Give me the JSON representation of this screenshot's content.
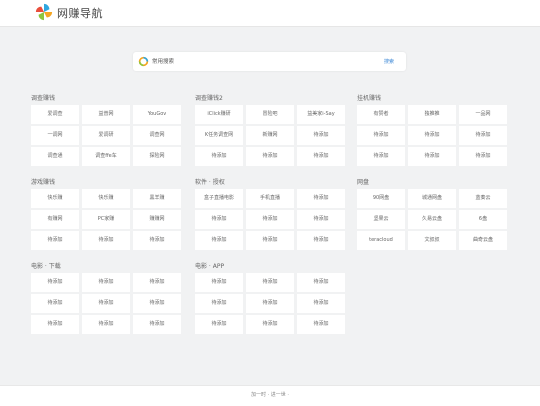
{
  "header": {
    "site_title": "网赚导航",
    "logo_colors": [
      "#2ea7e0",
      "#f5a623",
      "#8cc63f",
      "#e94e3c"
    ]
  },
  "search": {
    "engine_icon": "search-engine-ring-icon",
    "placeholder": "常用搜索",
    "button_label": "搜索"
  },
  "sections": [
    {
      "title": "调查赚钱",
      "items": [
        "爱调查",
        "益普网",
        "YouGov",
        "一调网",
        "爱调研",
        "调查网",
        "调查通",
        "调查ffe车",
        "探险网"
      ]
    },
    {
      "title": "调查赚钱2",
      "items": [
        "iClick赚研",
        "冒险吧",
        "益美家i-Say",
        "K任务调查网",
        "新赚网",
        "待添加",
        "待添加",
        "待添加",
        "待添加"
      ]
    },
    {
      "title": "挂机赚钱",
      "items": [
        "有赞者",
        "独推推",
        "一品网",
        "待添加",
        "待添加",
        "待添加",
        "待添加",
        "待添加",
        "待添加"
      ]
    },
    {
      "title": "游戏赚钱",
      "items": [
        "快乐赚",
        "快乐赚",
        "黑羊赚",
        "有赚网",
        "PC家赚",
        "赚赚网",
        "待添加",
        "待添加",
        "待添加"
      ]
    },
    {
      "title": "软件 · 授权",
      "items": [
        "盒子直播电影",
        "手机直播",
        "待添加",
        "待添加",
        "待添加",
        "待添加",
        "待添加",
        "待添加",
        "待添加"
      ]
    },
    {
      "title": "网盘",
      "items": [
        "90网盘",
        "城通网盘",
        "蓝奏云",
        "坚果云",
        "久易云盘",
        "6盘",
        "teracloud",
        "文叔叔",
        "曲奇云盘"
      ]
    },
    {
      "title": "电影 · 下载",
      "items": [
        "待添加",
        "待添加",
        "待添加",
        "待添加",
        "待添加",
        "待添加",
        "待添加",
        "待添加",
        "待添加"
      ]
    },
    {
      "title": "电影 · APP",
      "items": [
        "待添加",
        "待添加",
        "待添加",
        "待添加",
        "待添加",
        "待添加",
        "待添加",
        "待添加",
        "待添加"
      ]
    }
  ],
  "footer": {
    "text": "加一时 · 进一世 ·"
  }
}
